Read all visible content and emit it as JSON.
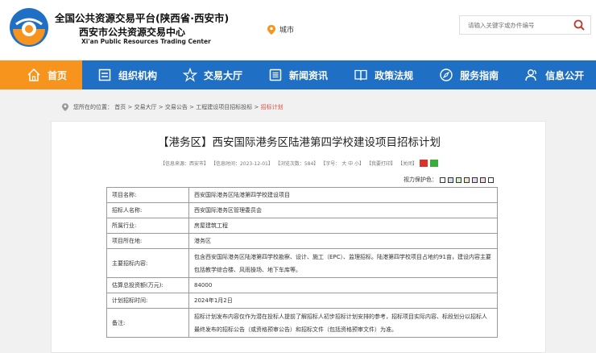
{
  "header": {
    "title_line1": "全国公共资源交易平台(陕西省·西安市)",
    "title_line2": "西安市公共资源交易中心",
    "title_en": "Xi'an Public Resources Trading Center",
    "city_label": "城市",
    "search_placeholder": "请输入关键字或办件编号"
  },
  "nav": {
    "items": [
      {
        "label": "首页",
        "icon": "home-icon"
      },
      {
        "label": "组织机构",
        "icon": "document-icon"
      },
      {
        "label": "交易大厅",
        "icon": "star-icon"
      },
      {
        "label": "新闻资讯",
        "icon": "news-icon"
      },
      {
        "label": "政策法规",
        "icon": "book-icon"
      },
      {
        "label": "服务指南",
        "icon": "compass-icon"
      },
      {
        "label": "信息公开",
        "icon": "people-icon"
      }
    ],
    "active_index": 0
  },
  "breadcrumb": {
    "prefix": "您所在的位置：",
    "items": [
      "首页",
      "交易大厅",
      "交易公告",
      "工程建设项目招标投标"
    ],
    "current": "招标计划",
    "separator": ">"
  },
  "article": {
    "title": "【港务区】西安国际港务区陆港第四学校建设项目招标计划",
    "meta": {
      "source": "【信息来源：西安市】",
      "time": "【信息时间：2023-12-01】",
      "views": "【浏览次数：584】",
      "font": "【字号： 大 中 小】",
      "print": "【我要打印】",
      "close": "【关闭】"
    },
    "vision_label": "视力保护色：",
    "vision_colors": [
      "#ffffff",
      "#f0e6c8",
      "#d8eec8",
      "#cde0f0",
      "#e6d8f0",
      "#f0d8e0",
      "#ffffff"
    ]
  },
  "table": [
    {
      "key": "项目名称:",
      "value": "西安国际港务区陆港第四学校建设项目"
    },
    {
      "key": "招标人名称:",
      "value": "西安国际港务区管理委员会"
    },
    {
      "key": "所属行业:",
      "value": "房屋建筑工程"
    },
    {
      "key": "项目所在地:",
      "value": "港务区"
    },
    {
      "key": "主要招标内容:",
      "value": "包含西安国际港务区陆港第四学校勘察、设计、施工（EPC）、监理招标。陆港第四学校项目占地约91亩，建设内容主要包括教学综合楼、风雨操场、地下车库等。"
    },
    {
      "key": "估算总投资额(万元):",
      "value": "84000"
    },
    {
      "key": "计划招标时间:",
      "value": "2024年1月2日"
    },
    {
      "key": "备注:",
      "value": "招标计划发布内容仅作为潜在投标人提前了解招标人初步招标计划安排的参考，招标项目实际内容、标段划分以招标人最终发布的招标公告（或资格预审公告）和招标文件（包括资格预审文件）为准。"
    }
  ]
}
